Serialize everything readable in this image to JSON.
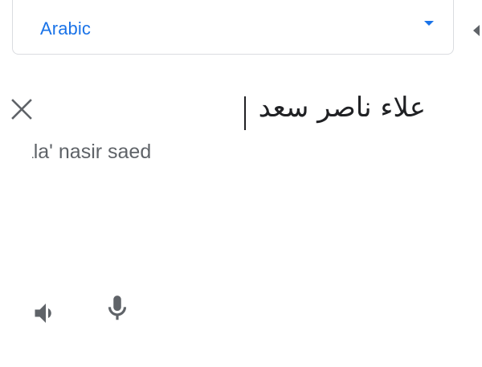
{
  "language_selector": {
    "selected": "Arabic"
  },
  "source": {
    "text": "علاء ناصر سعد",
    "transliteration": "eeala' nasir saed"
  },
  "icons": {
    "clear": "close-icon",
    "dropdown": "chevron-down-icon",
    "listen": "volume-icon",
    "voice": "microphone-icon"
  },
  "colors": {
    "accent": "#1a73e8",
    "icon": "#5f6368",
    "text": "#202124",
    "border": "#dadce0"
  }
}
